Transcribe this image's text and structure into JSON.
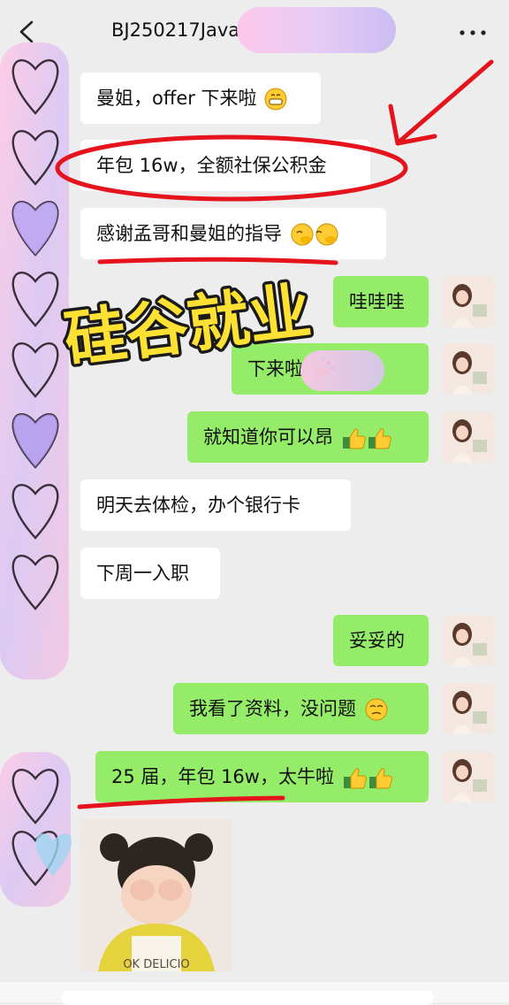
{
  "header": {
    "title": "BJ250217Java"
  },
  "messages": [
    {
      "side": "left",
      "text": "曼姐，offer 下来啦",
      "emoji": "grin-icon"
    },
    {
      "side": "left",
      "text": "年包 16w，全额社保公积金"
    },
    {
      "side": "left",
      "text": "感谢孟哥和曼姐的指导",
      "emoji": "salute-icon"
    },
    {
      "side": "right",
      "text": "哇哇哇"
    },
    {
      "side": "right",
      "text": "下来啦",
      "emoji": "party-popper-icon"
    },
    {
      "side": "right",
      "text": "就知道你可以昂",
      "emoji": "thumbs-up-icon"
    },
    {
      "side": "left",
      "text": "明天去体检，办个银行卡"
    },
    {
      "side": "left",
      "text": "下周一入职"
    },
    {
      "side": "right",
      "text": "妥妥的"
    },
    {
      "side": "right",
      "text": "我看了资料，没问题",
      "emoji": "thinking-icon"
    },
    {
      "side": "right",
      "text": "25 届，年包 16w，太牛啦",
      "emoji": "thumbs-up-icon"
    }
  ],
  "overlay": {
    "caption": "硅谷就业",
    "accent_color": "#e5131c",
    "caption_color": "#ffe133"
  },
  "photo": {
    "shirt_text": "OK DELICIO"
  },
  "colors": {
    "background": "#ededed",
    "bubble_left": "#ffffff",
    "bubble_right": "#95ec69"
  }
}
